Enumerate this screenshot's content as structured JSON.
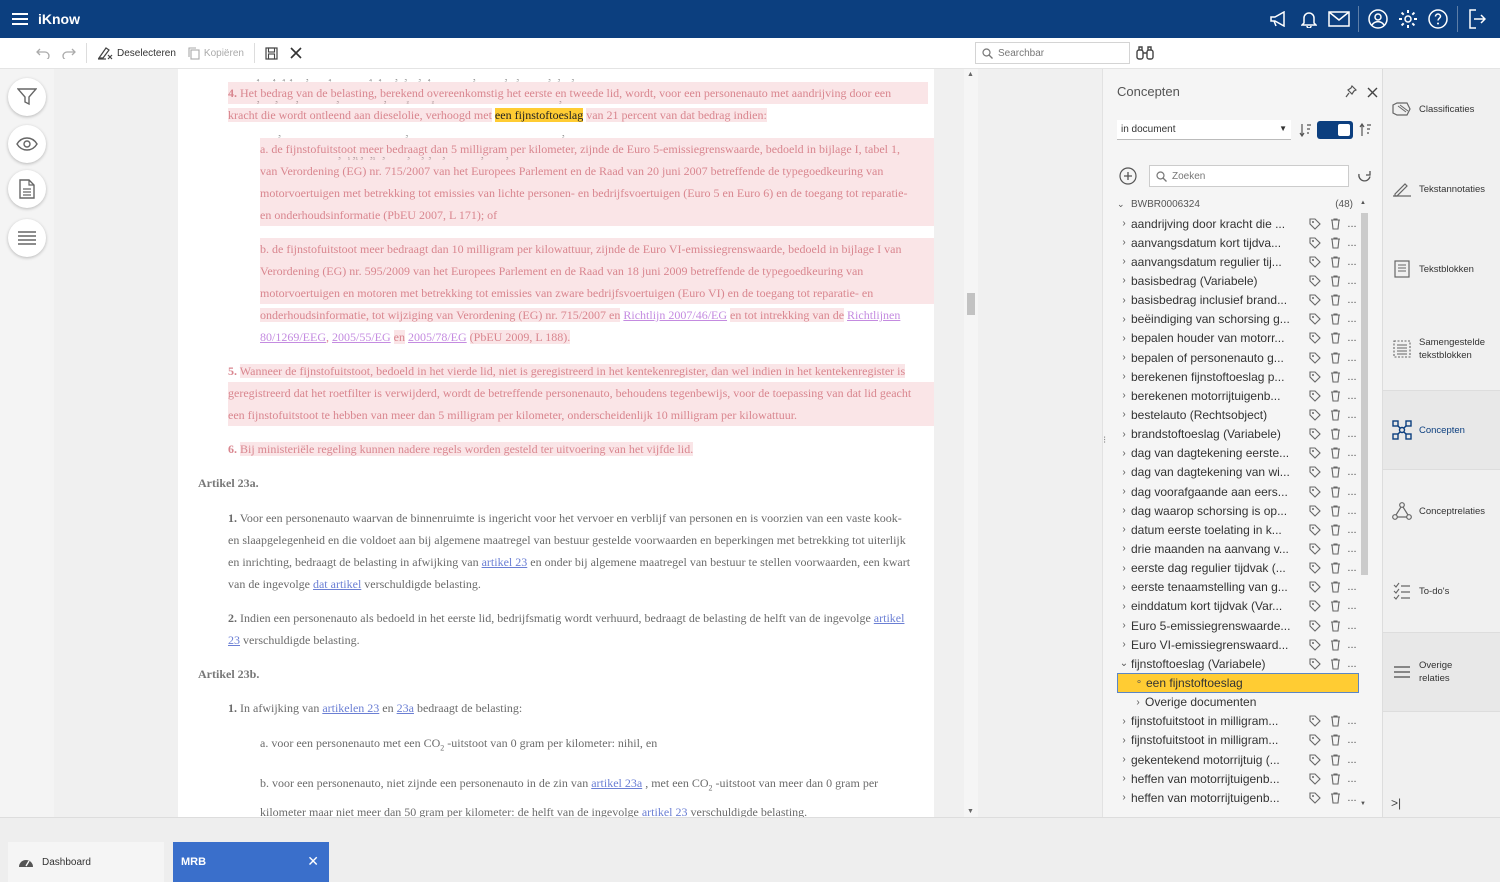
{
  "app": {
    "title": "iKnow"
  },
  "toolbar": {
    "deselect": "Deselecteren",
    "copy": "Kopiëren"
  },
  "search": {
    "placeholder": "Searchbar"
  },
  "document": {
    "p4": {
      "num": "4.",
      "line1": "Het bedrag van de belasting, berekend overeenkomstig het eerste en tweede lid, wordt, voor een personenauto met aandrijving door een",
      "line2a": "kracht die wordt ontleend aan dieselolie, verhoogd met",
      "line2b": "een fijnstoftoeslag",
      "line2c": "van 21 percent van dat bedrag indien:"
    },
    "pa": {
      "l1": "a. de fijnstofuitstoot meer bedraagt dan 5 milligram per kilometer, zijnde de Euro 5-emissiegrenswaarde, bedoeld in bijlage I, tabel 1,",
      "l2": "van Verordening (EG) nr. 715/2007 van het Europees Parlement en de Raad van 20 juni 2007 betreffende de typegoedkeuring van",
      "l3": "motorvoertuigen met betrekking tot emissies van lichte personen- en bedrijfsvoertuigen (Euro 5 en Euro 6) en de toegang tot reparatie-",
      "l4": "en onderhoudsinformatie (PbEU 2007, L 171); of"
    },
    "pb": {
      "l1": "b. de fijnstofuitstoot meer bedraagt dan 10 milligram per kilowattuur, zijnde de Euro VI-emissiegrenswaarde, bedoeld in bijlage I van",
      "l2": "Verordening (EG) nr. 595/2009 van het Europees Parlement en de Raad van 18 juni 2009 betreffende de typegoedkeuring van",
      "l3": "motorvoertuigen en motoren met betrekking tot emissies van zware bedrijfsvoertuigen (Euro VI) en de toegang tot reparatie- en",
      "l4a": "onderhoudsinformatie, tot wijziging van Verordening (EG) nr. 715/2007 en",
      "l4link": "Richtlijn 2007/46/EG",
      "l4b": "en tot intrekking van de",
      "l4link2": "Richtlijnen",
      "l5link1": "80/1269/EEG",
      "l5sep": ",",
      "l5link2": "2005/55/EG",
      "l5b": "en",
      "l5link3": "2005/78/EG",
      "l5c": "(PbEU 2009, L 188)."
    },
    "p5": {
      "num": "5.",
      "l1": "Wanneer de fijnstofuitstoot, bedoeld in het vierde lid, niet is geregistreerd in het kentekenregister, dan wel indien in het kentekenregister is",
      "l2": "geregistreerd dat het roetfilter is verwijderd, wordt de betreffende personenauto, behoudens tegenbewijs, voor de toepassing van dat lid geacht",
      "l3": "een fijnstofuitstoot te hebben van meer dan 5 milligram per kilometer, onderscheidenlijk 10 milligram per kilowattuur."
    },
    "p6": {
      "num": "6.",
      "l1": "Bij ministeriële regeling kunnen nadere regels worden gesteld ter uitvoering van het vijfde lid."
    },
    "art23a": {
      "heading": "Artikel 23a.",
      "p1num": "1.",
      "p1l1": "Voor een personenauto waarvan de binnenruimte is ingericht voor het vervoer en verblijf van personen en is voorzien van een vaste kook-",
      "p1l2": "en slaapgelegenheid en die voldoet aan bij algemene maatregel van bestuur gestelde voorwaarden en beperkingen met betrekking tot uiterlijk",
      "p1l3a": "en inrichting, bedraagt de belasting in afwijking van",
      "p1l3link": "artikel 23",
      "p1l3b": "en onder bij algemene maatregel van bestuur te stellen voorwaarden, een kwart",
      "p1l4a": "van de ingevolge",
      "p1l4link": "dat artikel",
      "p1l4b": "verschuldigde belasting.",
      "p2num": "2.",
      "p2l1a": "Indien een personenauto als bedoeld in het eerste lid, bedrijfsmatig wordt verhuurd, bedraagt de belasting de helft van de ingevolge",
      "p2l1link": "artikel",
      "p2l2link": "23",
      "p2l2b": "verschuldigde belasting."
    },
    "art23b": {
      "heading": "Artikel 23b.",
      "p1num": "1.",
      "p1a": "In afwijking van",
      "p1link1": "artikelen 23",
      "p1b": "en",
      "p1link2": "23a",
      "p1c": "bedraagt de belasting:",
      "a": "a. voor een personenauto met een CO",
      "a_sub": "2",
      "a_rest": "-uitstoot van 0 gram per kilometer: nihil, en",
      "b1a": "b. voor een personenauto, niet zijnde een personenauto in de zin van",
      "b1link": "artikel 23a",
      "b1b": ", met een CO",
      "b1sub": "2",
      "b1c": "-uitstoot van meer dan 0 gram per",
      "b2a": "kilometer maar niet meer dan 50 gram per kilometer: de helft van de ingevolge",
      "b2link": "artikel 23",
      "b2b": "verschuldigde belasting."
    }
  },
  "concepts": {
    "title": "Concepten",
    "scope": "in document",
    "search_placeholder": "Zoeken",
    "root": "BWBR0006324",
    "root_count": "(48)",
    "items": [
      "aandrijving door kracht die ...",
      "aanvangsdatum kort tijdva...",
      "aanvangsdatum regulier tij...",
      "basisbedrag (Variabele)",
      "basisbedrag inclusief brand...",
      "beëindiging van schorsing g...",
      "bepalen houder van motorr...",
      "bepalen of personenauto g...",
      "berekenen fijnstoftoeslag p...",
      "berekenen motorrijtuigenb...",
      "bestelauto (Rechtsobject)",
      "brandstoftoeslag (Variabele)",
      "dag van dagtekening eerste...",
      "dag van dagtekening van wi...",
      "dag voorafgaande aan eers...",
      "dag waarop schorsing is op...",
      "datum eerste toelating in k...",
      "drie maanden na aanvang v...",
      "eerste dag regulier tijdvak (...",
      "eerste tenaamstelling van g...",
      "einddatum kort tijdvak (Var...",
      "Euro 5-emissiegrenswaarde...",
      "Euro VI-emissiegrenswaard...",
      "fijnstoftoeslag (Variabele)"
    ],
    "expanded_selected": "een fijnstoftoeslag",
    "expanded_other": "Overige documenten",
    "items_after": [
      "fijnstofuitstoot in milligram...",
      "fijnstofuitstoot in milligram...",
      "gekentekend motorrijtuig (...",
      "heffen van motorrijtuigenb...",
      "heffen van motorrijtuigenb..."
    ]
  },
  "nav": {
    "classificaties": "Classificaties",
    "tekstannotaties": "Tekstannotaties",
    "tekstblokken": "Tekstblokken",
    "samengestelde1": "Samengestelde",
    "samengestelde2": "tekstblokken",
    "concepten": "Concepten",
    "conceptrelaties": "Conceptrelaties",
    "todos": "To-do's",
    "overige1": "Overige",
    "overige2": "relaties"
  },
  "tabs": {
    "dashboard": "Dashboard",
    "mrb": "MRB"
  },
  "colors": {
    "brand": "#0c3f7f",
    "accent": "#3a6fcb",
    "highlight": "#ffcc33"
  }
}
